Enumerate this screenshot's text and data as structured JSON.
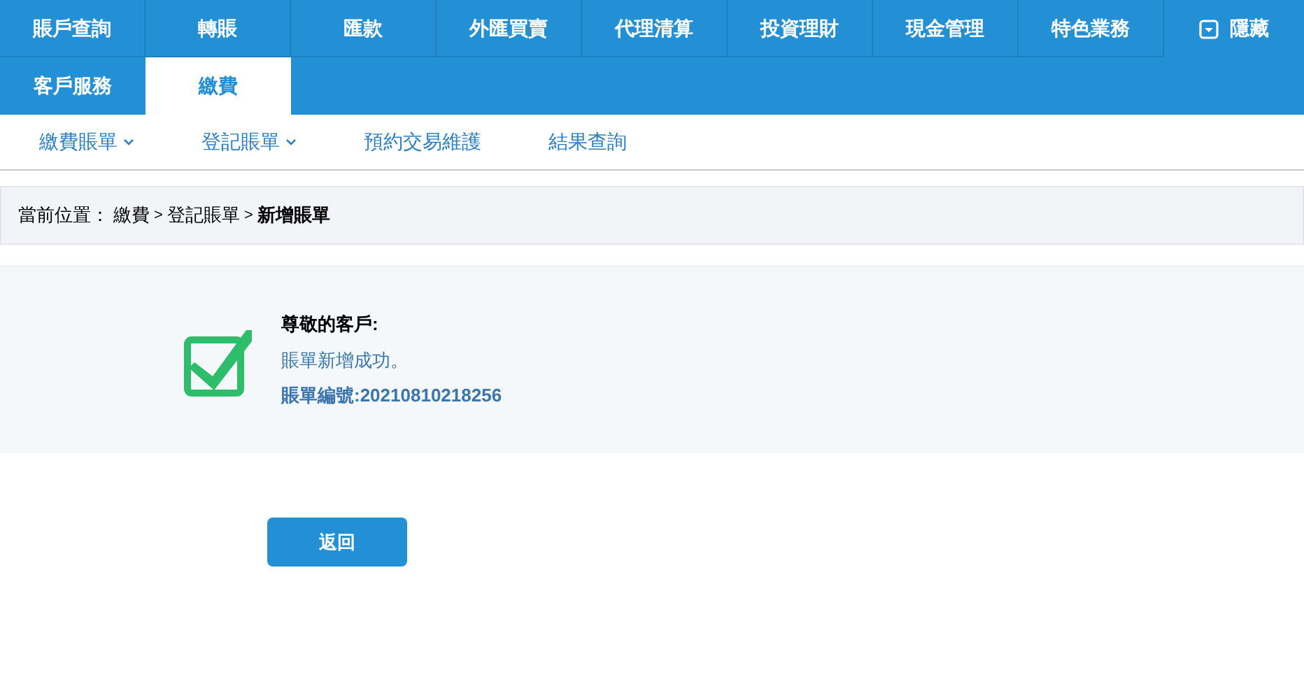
{
  "main_nav": {
    "rows": [
      [
        {
          "label": "賬戶查詢",
          "selected": false
        },
        {
          "label": "轉賬",
          "selected": false
        },
        {
          "label": "匯款",
          "selected": false
        },
        {
          "label": "外匯買賣",
          "selected": false
        },
        {
          "label": "代理清算",
          "selected": false
        },
        {
          "label": "投資理財",
          "selected": false
        },
        {
          "label": "現金管理",
          "selected": false
        },
        {
          "label": "特色業務",
          "selected": false
        }
      ],
      [
        {
          "label": "客戶服務",
          "selected": false
        },
        {
          "label": "繳費",
          "selected": true
        }
      ]
    ],
    "hide_button": {
      "label": "隱藏"
    }
  },
  "sub_nav": [
    {
      "label": "繳費賬單",
      "dropdown": true
    },
    {
      "label": "登記賬單",
      "dropdown": true
    },
    {
      "label": "預約交易維護",
      "dropdown": false
    },
    {
      "label": "結果查詢",
      "dropdown": false
    }
  ],
  "breadcrumb": {
    "label": "當前位置：",
    "separator": ">",
    "items": [
      "繳費",
      "登記賬單",
      "新增賬單"
    ]
  },
  "result": {
    "success": true,
    "greeting": "尊敬的客戶:",
    "message": "賬單新增成功。",
    "bill_number": "賬單編號:20210810218256"
  },
  "back_button": {
    "label": "返回"
  }
}
